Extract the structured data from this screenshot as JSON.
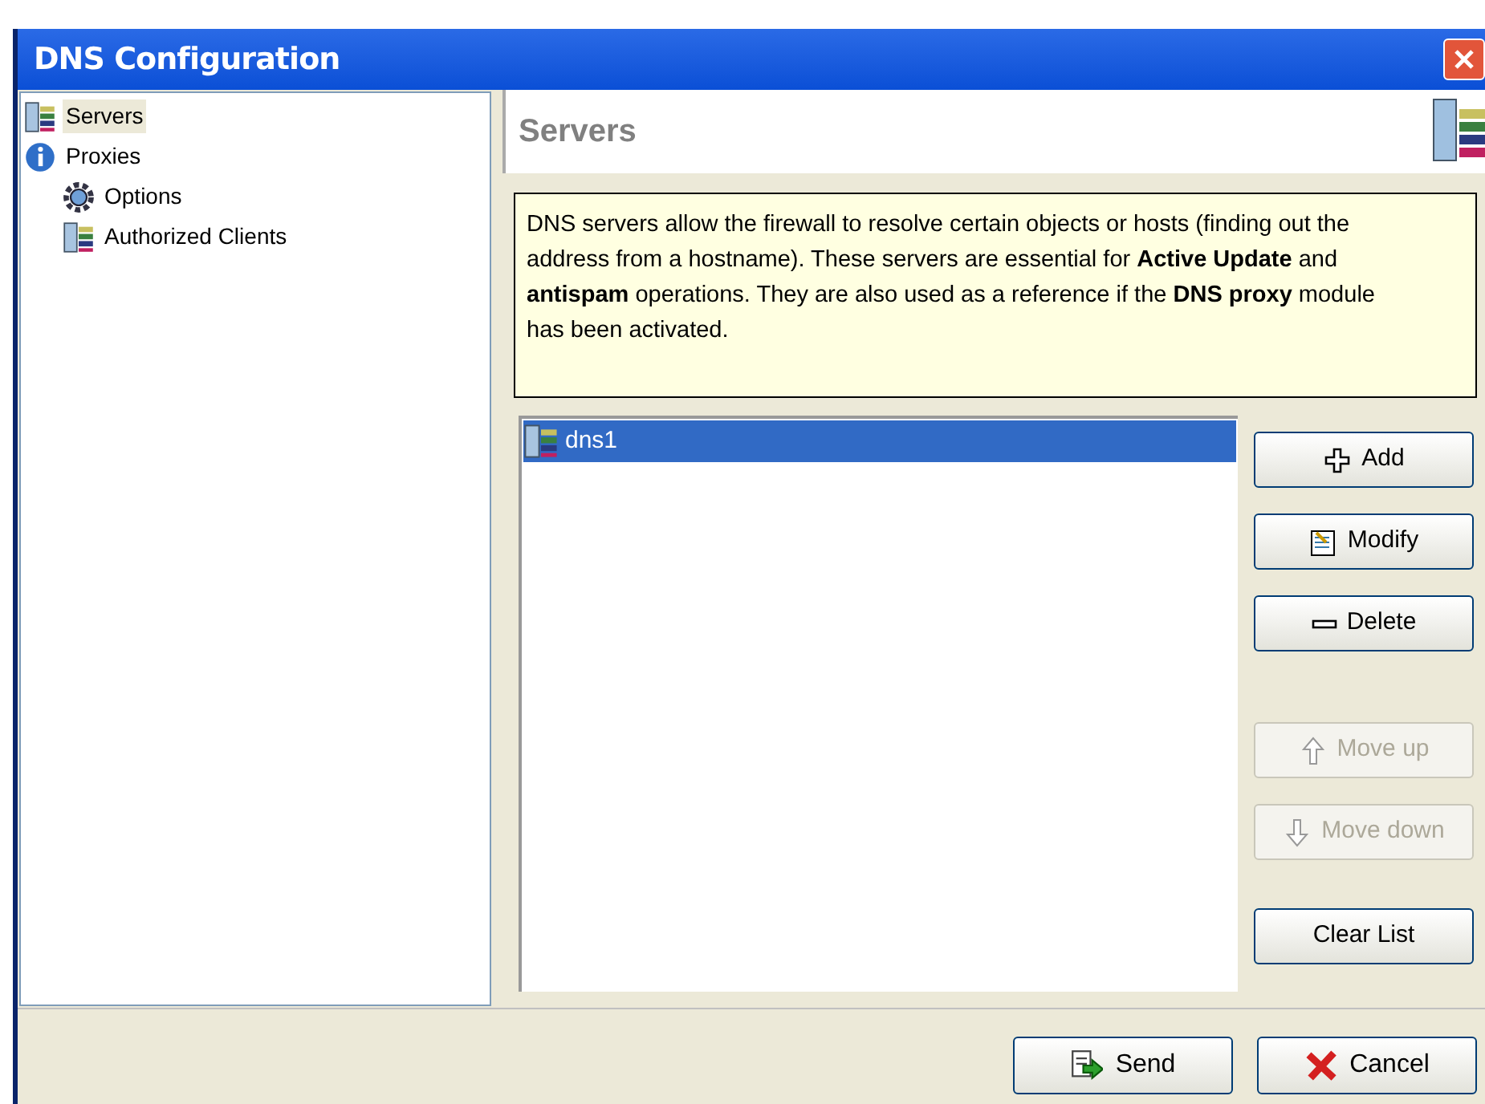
{
  "window": {
    "title": "DNS Configuration"
  },
  "tree": [
    {
      "label": "Servers",
      "kind": "servers",
      "selected": true
    },
    {
      "label": "Proxies",
      "kind": "info",
      "selected": false,
      "children": [
        {
          "label": "Options",
          "kind": "gear",
          "selected": false
        },
        {
          "label": "Authorized Clients",
          "kind": "servers",
          "selected": false
        }
      ]
    }
  ],
  "panel": {
    "title": "Servers",
    "description": "DNS servers allow the firewall to resolve certain objects or hosts (finding out the address from a hostname). These servers are essential for **Active Update** and **antispam** operations. They are also used as a reference if the **DNS proxy** module has been activated."
  },
  "servers": [
    {
      "name": "dns1",
      "selected": true
    }
  ],
  "actions": [
    {
      "label": "Add",
      "kind": "add",
      "disabled": false
    },
    {
      "label": "Modify",
      "kind": "modify",
      "disabled": false
    },
    {
      "label": "Delete",
      "kind": "delete",
      "disabled": false
    },
    {
      "label": "Move up",
      "kind": "up",
      "disabled": true
    },
    {
      "label": "Move down",
      "kind": "down",
      "disabled": true
    },
    {
      "label": "Clear List",
      "kind": "plain",
      "disabled": false
    }
  ],
  "footer": [
    {
      "label": "Send",
      "kind": "send"
    },
    {
      "label": "Cancel",
      "kind": "cancel"
    }
  ]
}
